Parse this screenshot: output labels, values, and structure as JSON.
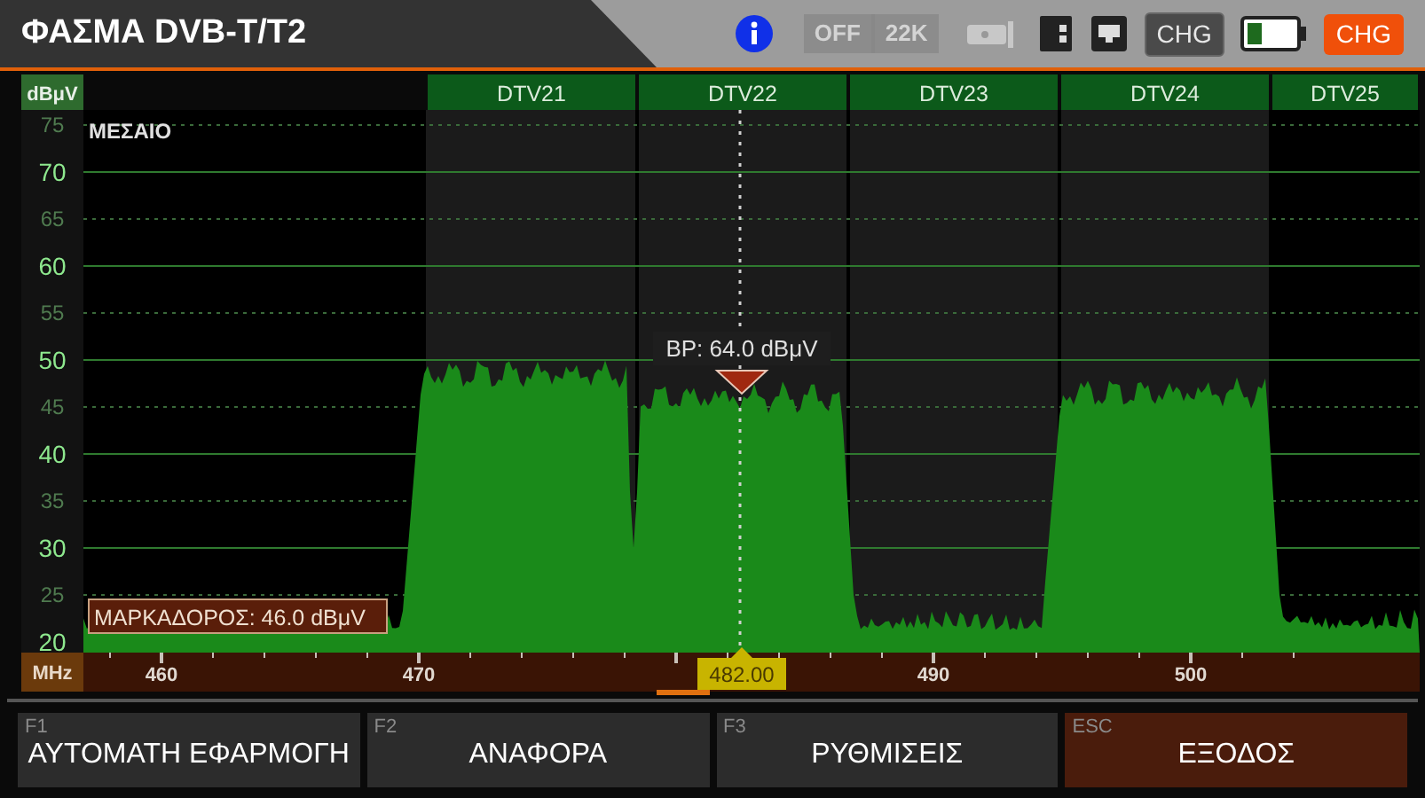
{
  "title": "ΦΑΣΜΑ DVB-T/T2",
  "status": {
    "lnb_power": "OFF",
    "tone": "22K",
    "charge_label": "CHG",
    "charge_badge": "CHG"
  },
  "chart": {
    "unit": "dBμV",
    "mode": "ΜΕΣΑΙΟ",
    "channels": [
      "DTV21",
      "DTV22",
      "DTV23",
      "DTV24",
      "DTV25"
    ],
    "y_ticks": [
      {
        "label": "75",
        "major": false
      },
      {
        "label": "70",
        "major": true
      },
      {
        "label": "65",
        "major": false
      },
      {
        "label": "60",
        "major": true
      },
      {
        "label": "55",
        "major": false
      },
      {
        "label": "50",
        "major": true
      },
      {
        "label": "45",
        "major": false
      },
      {
        "label": "40",
        "major": true
      },
      {
        "label": "35",
        "major": false
      },
      {
        "label": "30",
        "major": true
      },
      {
        "label": "25",
        "major": false
      },
      {
        "label": "20",
        "major": true
      }
    ],
    "freq_unit": "MHz",
    "x_ticks": [
      "460",
      "470",
      "490",
      "500"
    ],
    "marker_label": "ΜΑΡΚΑΔΟΡΟΣ: 46.0 dBμV",
    "marker_frequency": "482.00",
    "peak_label": "BP: 64.0 dBμV"
  },
  "function_keys": [
    {
      "key": "F1",
      "label": "ΑΥΤΟΜΑΤΗ ΕΦΑΡΜΟΓΗ",
      "kind": "normal"
    },
    {
      "key": "F2",
      "label": "ΑΝΑΦΟΡΑ",
      "kind": "normal"
    },
    {
      "key": "F3",
      "label": "ΡΥΘΜΙΣΕΙΣ",
      "kind": "normal"
    },
    {
      "key": "ESC",
      "label": "ΕΞΟΔΟΣ",
      "kind": "exit"
    }
  ]
}
